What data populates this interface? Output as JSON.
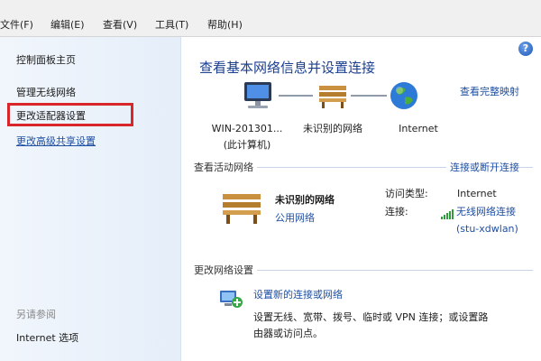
{
  "menu": [
    "文件(F)",
    "编辑(E)",
    "查看(V)",
    "工具(T)",
    "帮助(H)"
  ],
  "sidebar": {
    "control_panel_home": "控制面板主页",
    "manage_wireless": "管理无线网络",
    "change_adapter": "更改适配器设置",
    "change_sharing": "更改高级共享设置",
    "see_also": "另请参阅",
    "internet_options": "Internet 选项"
  },
  "help_glyph": "?",
  "main": {
    "title": "查看基本网络信息并设置连接",
    "view_full_map": "查看完整映射",
    "map": {
      "computer_name": "WIN-201301...",
      "computer_sub": "(此计算机)",
      "network_name": "未识别的网络",
      "internet": "Internet"
    },
    "active": {
      "section": "查看活动网络",
      "connect_link": "连接或断开连接",
      "network_name": "未识别的网络",
      "network_type": "公用网络",
      "access_type_label": "访问类型:",
      "access_type_value": "Internet",
      "connection_label": "连接:",
      "connection_value": "无线网络连接",
      "ssid": "(stu-xdwlan)"
    },
    "change": {
      "section": "更改网络设置",
      "new_connection_link": "设置新的连接或网络",
      "description_line1": "设置无线、宽带、拨号、临时或 VPN 连接；或设置路",
      "description_line2": "由器或访问点。"
    }
  },
  "colors": {
    "accent": "#1e4fa3",
    "title": "#1b3e8f",
    "highlight": "#d8262b"
  }
}
